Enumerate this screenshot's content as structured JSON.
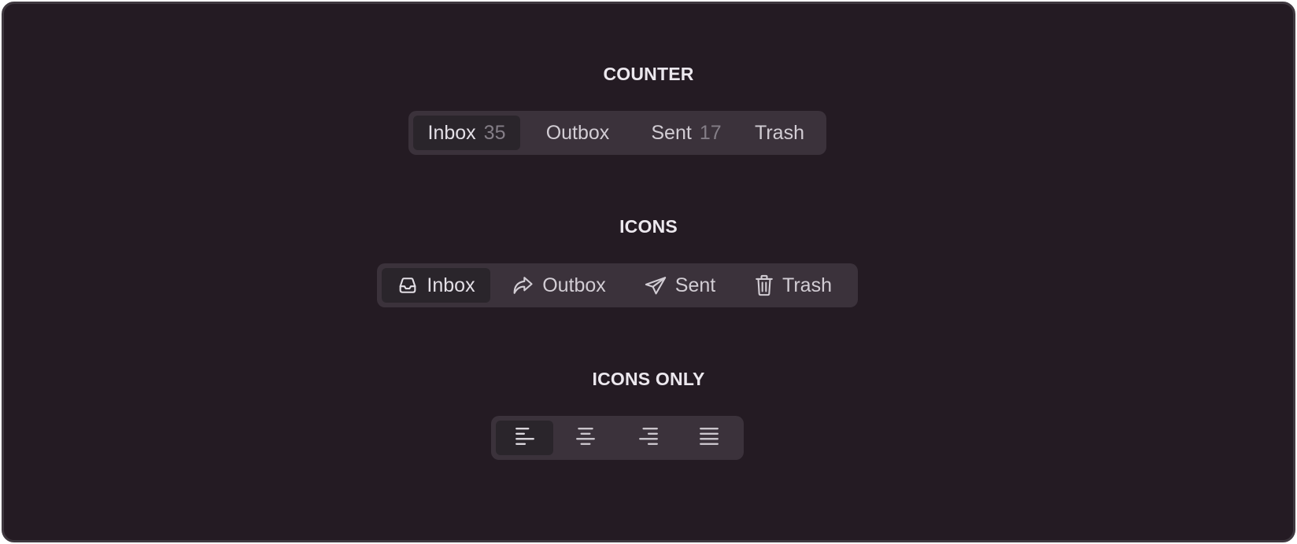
{
  "sections": {
    "counter": {
      "title": "COUNTER",
      "items": [
        {
          "label": "Inbox",
          "count": "35",
          "active": true
        },
        {
          "label": "Outbox",
          "count": "",
          "active": false
        },
        {
          "label": "Sent",
          "count": "17",
          "active": false
        },
        {
          "label": "Trash",
          "count": "",
          "active": false
        }
      ]
    },
    "icons": {
      "title": "ICONS",
      "items": [
        {
          "label": "Inbox",
          "icon": "inbox-icon",
          "active": true
        },
        {
          "label": "Outbox",
          "icon": "share-arrow-icon",
          "active": false
        },
        {
          "label": "Sent",
          "icon": "paper-plane-icon",
          "active": false
        },
        {
          "label": "Trash",
          "icon": "trash-icon",
          "active": false
        }
      ]
    },
    "icons_only": {
      "title": "ICONS ONLY",
      "items": [
        {
          "icon": "align-left-icon",
          "active": true
        },
        {
          "icon": "align-center-icon",
          "active": false
        },
        {
          "icon": "align-right-icon",
          "active": false
        },
        {
          "icon": "align-justify-icon",
          "active": false
        }
      ]
    }
  },
  "colors": {
    "background": "#241b23",
    "frame_border": "#3f383f",
    "control_bg": "#3b323b",
    "active_bg": "#2a252b",
    "text": "#d2cdd4",
    "counter_text": "#847e87",
    "title_text": "#ece8ee"
  }
}
